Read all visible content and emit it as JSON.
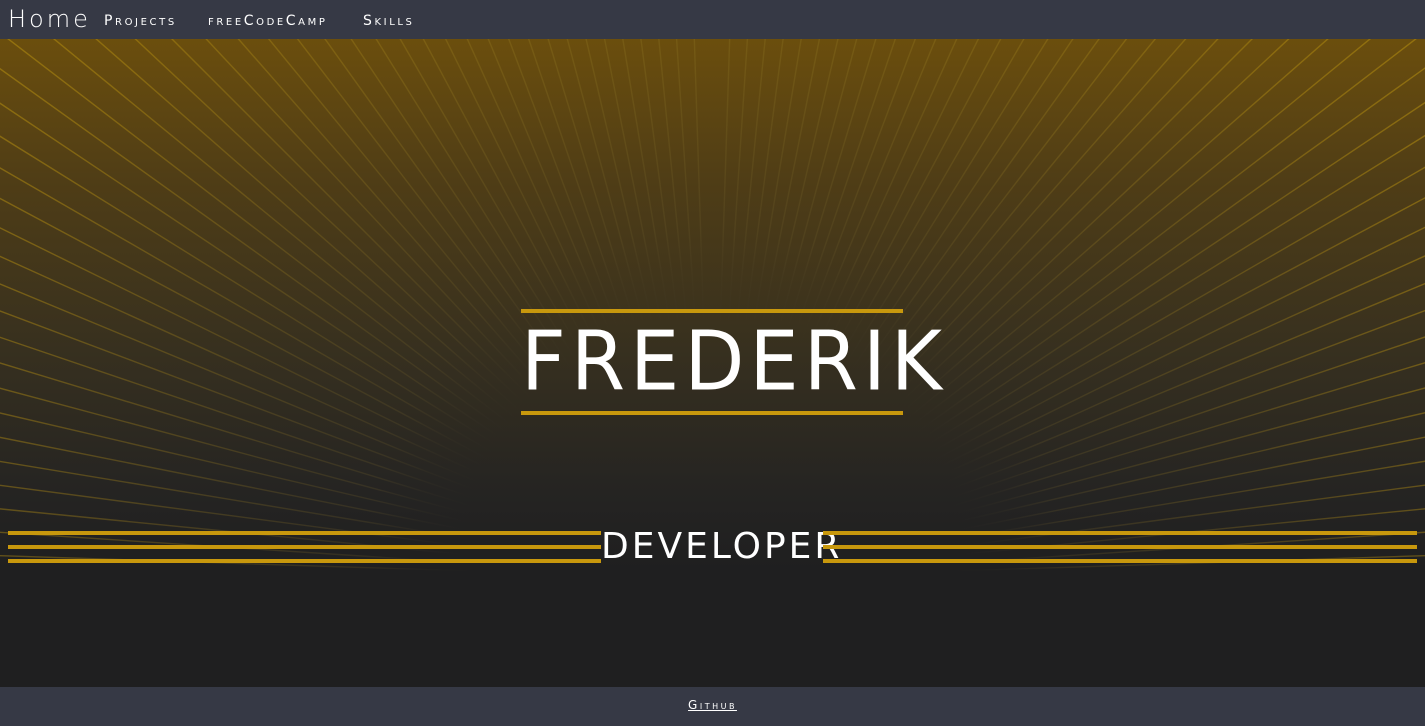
{
  "nav": {
    "home": "Home",
    "projects": "Projects",
    "freecodecamp": "freeCodeCamp",
    "skills": "Skills"
  },
  "hero": {
    "name": "FREDERIK",
    "role": "DEVELOPER"
  },
  "footer": {
    "github": "Github"
  },
  "colors": {
    "nav_bg": "#363945",
    "page_bg": "#1f1f20",
    "gold": "#c8980d",
    "ray": "#b8910f",
    "text": "#ffffff"
  }
}
